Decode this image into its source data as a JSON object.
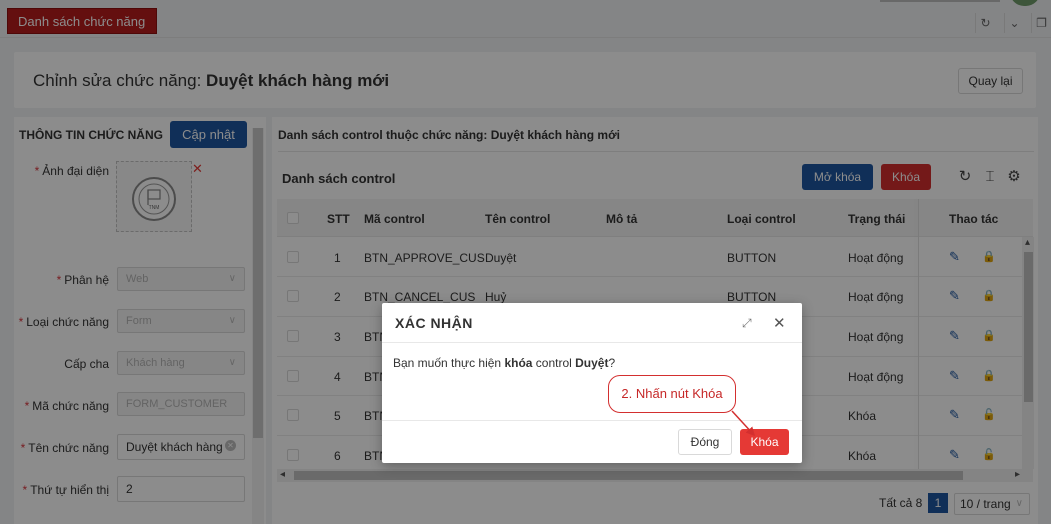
{
  "tab": {
    "label": "Danh sách chức năng"
  },
  "header": {
    "prefix": "Chỉnh sửa chức năng:",
    "name": "Duyệt khách hàng mới",
    "back_label": "Quay lại"
  },
  "left": {
    "title": "THÔNG TIN CHỨC NĂNG",
    "update_label": "Cập nhật",
    "avatar_label": "Ảnh đại diện",
    "avatar_logo_text": "TNM",
    "fields": [
      {
        "label": "Phân hệ",
        "required": true,
        "value": "Web",
        "kind": "select"
      },
      {
        "label": "Loại chức năng",
        "required": true,
        "value": "Form",
        "kind": "select"
      },
      {
        "label": "Cấp cha",
        "required": false,
        "value": "Khách hàng",
        "kind": "select"
      },
      {
        "label": "Mã chức năng",
        "required": true,
        "value": "FORM_CUSTOMER",
        "kind": "disabled"
      },
      {
        "label": "Tên chức năng",
        "required": true,
        "value": "Duyệt khách hàng",
        "kind": "input-clear"
      },
      {
        "label": "Thứ tự hiển thị",
        "required": true,
        "value": "2",
        "kind": "input"
      }
    ]
  },
  "right": {
    "title": "Danh sách control thuộc chức năng: Duyệt khách hàng mới",
    "list_title": "Danh sách control",
    "unlock_label": "Mở khóa",
    "lock_label": "Khóa",
    "columns": [
      "STT",
      "Mã control",
      "Tên control",
      "Mô tả",
      "Loại control",
      "Trạng thái",
      "Thao tác"
    ],
    "rows": [
      {
        "stt": "1",
        "code": "BTN_APPROVE_CUS",
        "name": "Duyệt",
        "desc": "",
        "type": "BUTTON",
        "status": "Hoạt động",
        "locked": false
      },
      {
        "stt": "2",
        "code": "BTN_CANCEL_CUS",
        "name": "Huỷ",
        "desc": "",
        "type": "BUTTON",
        "status": "Hoạt động",
        "locked": false
      },
      {
        "stt": "3",
        "code": "BTN",
        "name": "",
        "desc": "",
        "type": "",
        "status": "Hoạt động",
        "locked": false
      },
      {
        "stt": "4",
        "code": "BTN",
        "name": "",
        "desc": "",
        "type": "",
        "status": "Hoạt động",
        "locked": false
      },
      {
        "stt": "5",
        "code": "BTN",
        "name": "",
        "desc": "",
        "type": "",
        "status": "Khóa",
        "locked": true
      },
      {
        "stt": "6",
        "code": "BTN",
        "name": "",
        "desc": "",
        "type": "",
        "status": "Khóa",
        "locked": true
      }
    ],
    "total_label": "Tất cả 8",
    "page": "1",
    "page_size": "10 / trang"
  },
  "modal": {
    "title": "XÁC NHẬN",
    "body_pre": "Bạn muốn thực hiện ",
    "body_action": "khóa",
    "body_mid": " control ",
    "body_target": "Duyệt",
    "body_post": "?",
    "close_label": "Đóng",
    "confirm_label": "Khóa"
  },
  "callout": {
    "text": "2. Nhấn nút Khóa"
  },
  "colors": {
    "brand_red": "#b71c1c",
    "primary_blue": "#1e56a0",
    "danger": "#e53935"
  },
  "icons": [
    "refresh-icon",
    "chevron-down-icon",
    "fullscreen-icon",
    "reload-icon",
    "column-height-icon",
    "settings-icon",
    "edit-icon",
    "lock-icon",
    "unlock-icon",
    "close-icon",
    "maximize-icon"
  ]
}
